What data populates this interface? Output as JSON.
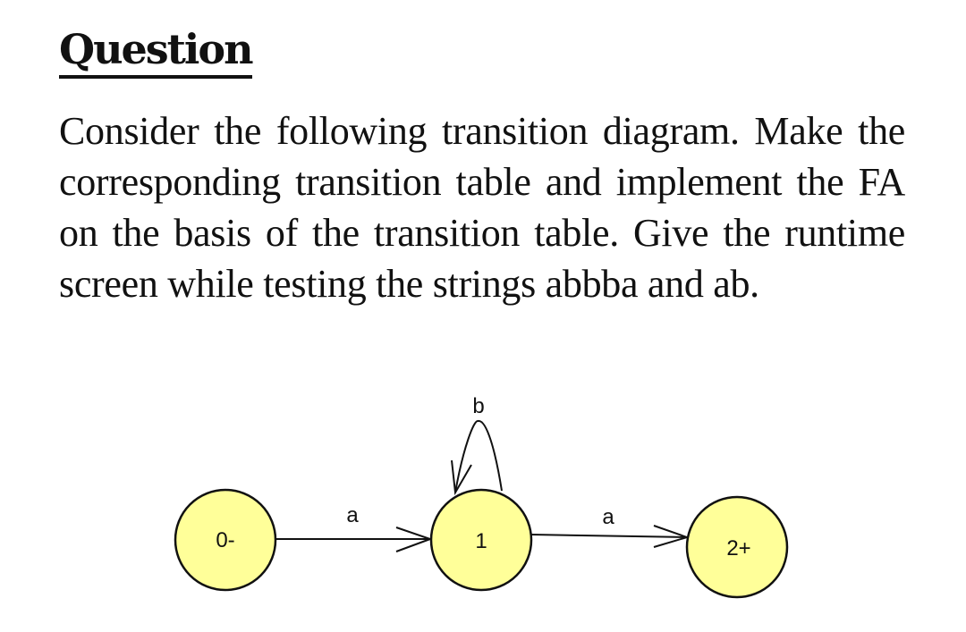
{
  "question": {
    "heading": "Question",
    "text": "Consider the following transition diagram. Make the corresponding transition table and implement the FA on the basis of the transition table. Give the runtime screen while testing the strings abbba and ab."
  },
  "diagram": {
    "colors": {
      "state_fill": "#FFFF99",
      "stroke": "#111111"
    },
    "states": [
      {
        "id": "0",
        "label": "0-",
        "initial": true,
        "final": false
      },
      {
        "id": "1",
        "label": "1",
        "initial": false,
        "final": false
      },
      {
        "id": "2",
        "label": "2+",
        "initial": false,
        "final": true
      }
    ],
    "transitions": [
      {
        "from": "0",
        "to": "1",
        "label": "a"
      },
      {
        "from": "1",
        "to": "1",
        "label": "b"
      },
      {
        "from": "1",
        "to": "2",
        "label": "a"
      }
    ]
  }
}
